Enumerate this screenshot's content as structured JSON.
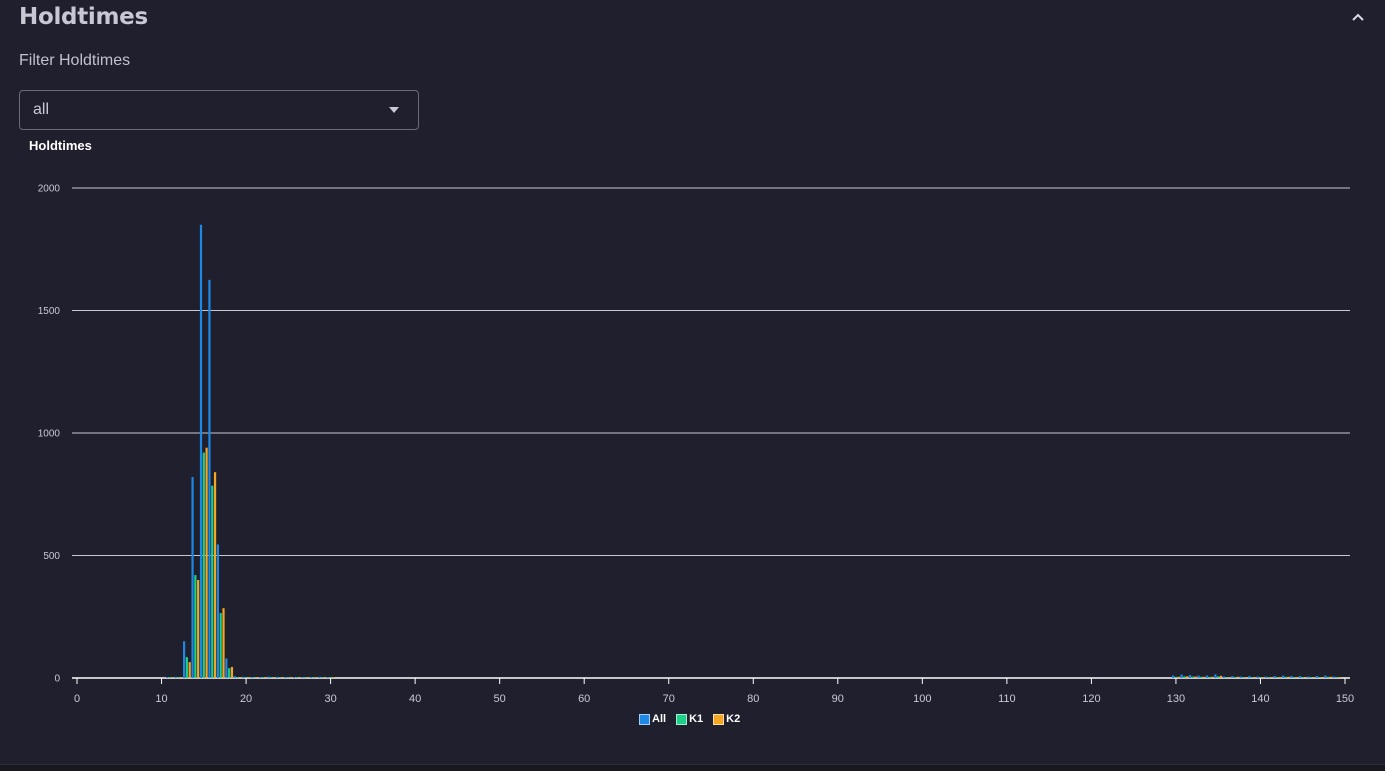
{
  "panel": {
    "title": "Holdtimes"
  },
  "filter": {
    "label": "Filter Holdtimes",
    "value": "all"
  },
  "icons": {
    "collapse": "chevron-up-icon",
    "dropdown": "caret-down-icon"
  },
  "chart_data": {
    "type": "bar",
    "title": "Holdtimes",
    "xlabel": "",
    "ylabel": "",
    "xlim": [
      0,
      150
    ],
    "ylim": [
      0,
      2000
    ],
    "xticks": [
      0,
      10,
      20,
      30,
      40,
      50,
      60,
      70,
      80,
      90,
      100,
      110,
      120,
      130,
      140,
      150
    ],
    "yticks": [
      0,
      500,
      1000,
      1500,
      2000
    ],
    "grid": true,
    "legend_position": "bottom-center",
    "x": [
      11,
      12,
      13,
      14,
      15,
      16,
      17,
      18,
      19,
      20,
      21,
      22,
      23,
      24,
      25,
      26,
      27,
      28,
      29,
      30,
      130,
      131,
      132,
      133,
      134,
      135,
      136,
      137,
      138,
      139,
      140,
      141,
      142,
      143,
      144,
      145,
      146,
      147,
      148,
      149
    ],
    "series": [
      {
        "name": "All",
        "color": "#1e88e5",
        "values": [
          2,
          5,
          150,
          820,
          1850,
          1625,
          545,
          80,
          8,
          5,
          4,
          4,
          6,
          5,
          4,
          4,
          3,
          3,
          5,
          3,
          10,
          14,
          12,
          10,
          10,
          15,
          6,
          8,
          6,
          8,
          6,
          6,
          8,
          10,
          8,
          8,
          6,
          8,
          10,
          6
        ]
      },
      {
        "name": "K1",
        "color": "#1ecf8a",
        "values": [
          1,
          3,
          85,
          420,
          920,
          785,
          265,
          40,
          4,
          2,
          2,
          2,
          3,
          3,
          2,
          2,
          2,
          2,
          2,
          2,
          5,
          7,
          6,
          5,
          5,
          7,
          3,
          4,
          3,
          4,
          3,
          3,
          4,
          5,
          4,
          4,
          3,
          4,
          5,
          3
        ]
      },
      {
        "name": "K2",
        "color": "#f5a623",
        "values": [
          1,
          2,
          65,
          400,
          940,
          840,
          285,
          45,
          4,
          3,
          2,
          2,
          3,
          2,
          2,
          2,
          1,
          1,
          3,
          1,
          5,
          7,
          6,
          5,
          5,
          9,
          3,
          5,
          3,
          4,
          3,
          3,
          4,
          5,
          4,
          4,
          3,
          4,
          5,
          3
        ]
      }
    ]
  }
}
